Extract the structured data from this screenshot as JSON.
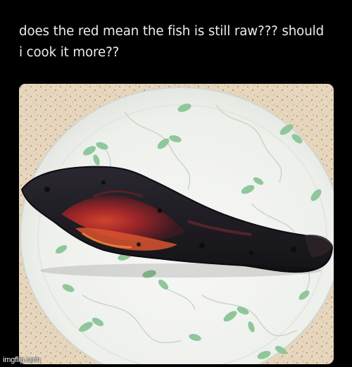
{
  "post": {
    "caption_line1": "does the red mean the fish is still raw??? should",
    "caption_line2": "i cook it more??"
  },
  "photo": {
    "subject": "charred fish fillet on a white plate with green leaf pattern"
  },
  "watermark": {
    "text": "imgflip.com"
  },
  "colors": {
    "background": "#000000",
    "caption_text": "#ededed",
    "countertop": "#e8d9c0",
    "plate": "#f3f4f1",
    "leaf_pattern": "#8fc79a",
    "char": "#1c1a1c",
    "ember_red": "#c8322a"
  }
}
